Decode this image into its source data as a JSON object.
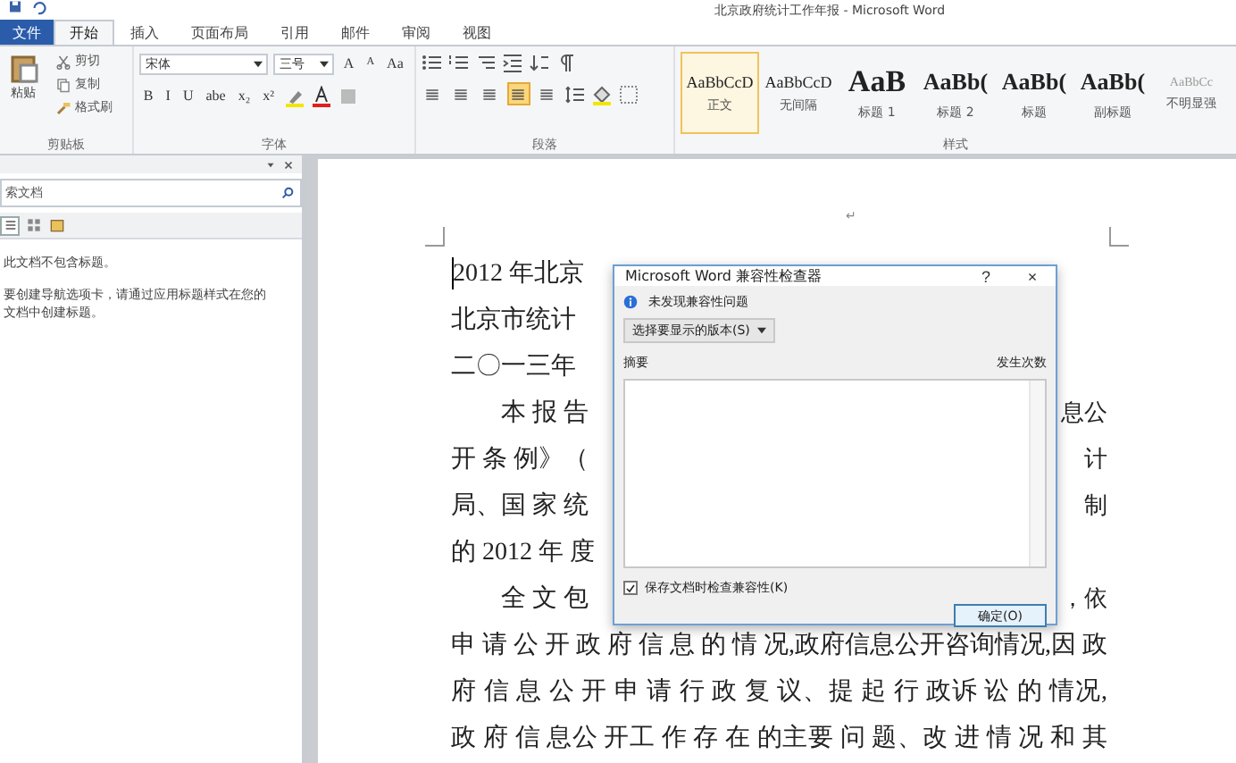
{
  "window": {
    "title": "北京政府统计工作年报 - Microsoft Word"
  },
  "tabs": [
    {
      "label": "文件",
      "kind": "file",
      "selected": false
    },
    {
      "label": "开始",
      "kind": "tab",
      "selected": true
    },
    {
      "label": "插入",
      "kind": "tab",
      "selected": false
    },
    {
      "label": "页面布局",
      "kind": "tab",
      "selected": false
    },
    {
      "label": "引用",
      "kind": "tab",
      "selected": false
    },
    {
      "label": "邮件",
      "kind": "tab",
      "selected": false
    },
    {
      "label": "审阅",
      "kind": "tab",
      "selected": false
    },
    {
      "label": "视图",
      "kind": "tab",
      "selected": false
    }
  ],
  "clipboard": {
    "paste": "粘贴",
    "items": [
      "剪切",
      "复制",
      "格式刷"
    ],
    "label": "剪贴板"
  },
  "font": {
    "name": "宋体",
    "size": "三号",
    "row1_buttons": [
      "A",
      "A",
      "Aa"
    ],
    "row2_buttons": [
      "B",
      "I",
      "U",
      "abe",
      "x₂",
      "x²"
    ],
    "label": "字体"
  },
  "paragraph": {
    "align_buttons": [
      {
        "selected": false
      },
      {
        "selected": false
      },
      {
        "selected": false
      },
      {
        "selected": true
      },
      {
        "selected": false
      }
    ],
    "label": "段落"
  },
  "styles": {
    "items": [
      {
        "sample": "AaBbCcD",
        "name": "正文",
        "kind": "normal",
        "selected": true
      },
      {
        "sample": "AaBbCcD",
        "name": "无间隔",
        "kind": "normal",
        "selected": false
      },
      {
        "sample": "AaB",
        "name": "标题 1",
        "kind": "heading1",
        "selected": false
      },
      {
        "sample": "AaBb(",
        "name": "标题 2",
        "kind": "heading",
        "selected": false
      },
      {
        "sample": "AaBb(",
        "name": "标题",
        "kind": "heading",
        "selected": false
      },
      {
        "sample": "AaBb(",
        "name": "副标题",
        "kind": "heading",
        "selected": false
      },
      {
        "sample": "AaBbCc",
        "name": "不明显强",
        "kind": "faint",
        "selected": false
      }
    ],
    "label": "样式"
  },
  "navigation": {
    "search": {
      "placeholder": "索文档"
    },
    "tabs": [
      {
        "selected": true
      },
      {
        "selected": false
      },
      {
        "selected": false
      }
    ],
    "messages": [
      "此文档不包含标题。",
      "要创建导航选项卡，请通过应用标题样式在您的文档中创建标题。"
    ]
  },
  "document": {
    "header_mark": "↵",
    "lines": [
      {
        "left": "2012 年北京",
        "kind": "plain"
      },
      {
        "left": "北京市统计",
        "kind": "plain"
      },
      {
        "left": "二〇一三年",
        "kind": "plain"
      },
      {
        "left": "　　本 报 告",
        "right": "息公",
        "kind": "split"
      },
      {
        "left": "开 条 例》（",
        "right": "计",
        "kind": "split"
      },
      {
        "left": "局、国 家 统",
        "right": "制",
        "kind": "split"
      },
      {
        "left": "的 2012 年 度",
        "kind": "split"
      },
      {
        "left": "　　全 文 包",
        "right": "，依",
        "kind": "split"
      },
      {
        "left": "申 请 公 开 政 府 信 息 的 情 况,政府信息公开咨询情况,因 政",
        "kind": "full"
      },
      {
        "left": "府 信 息 公 开 申 请 行 政 复 议、提 起 行 政诉 讼 的 情况,",
        "kind": "full"
      },
      {
        "left": "政 府 信 息公 开工 作 存 在 的主要 问 题、改 进 情 况 和 其",
        "kind": "full"
      }
    ]
  },
  "dialog": {
    "title": "Microsoft Word 兼容性检查器",
    "help": "?",
    "close": "×",
    "status": "未发现兼容性问题",
    "version_button": "选择要显示的版本(S)",
    "columns": [
      "摘要",
      "发生次数"
    ],
    "check_on_save": {
      "label": "保存文档时检查兼容性(K)",
      "checked": true
    },
    "ok_button": "确定(O)"
  }
}
